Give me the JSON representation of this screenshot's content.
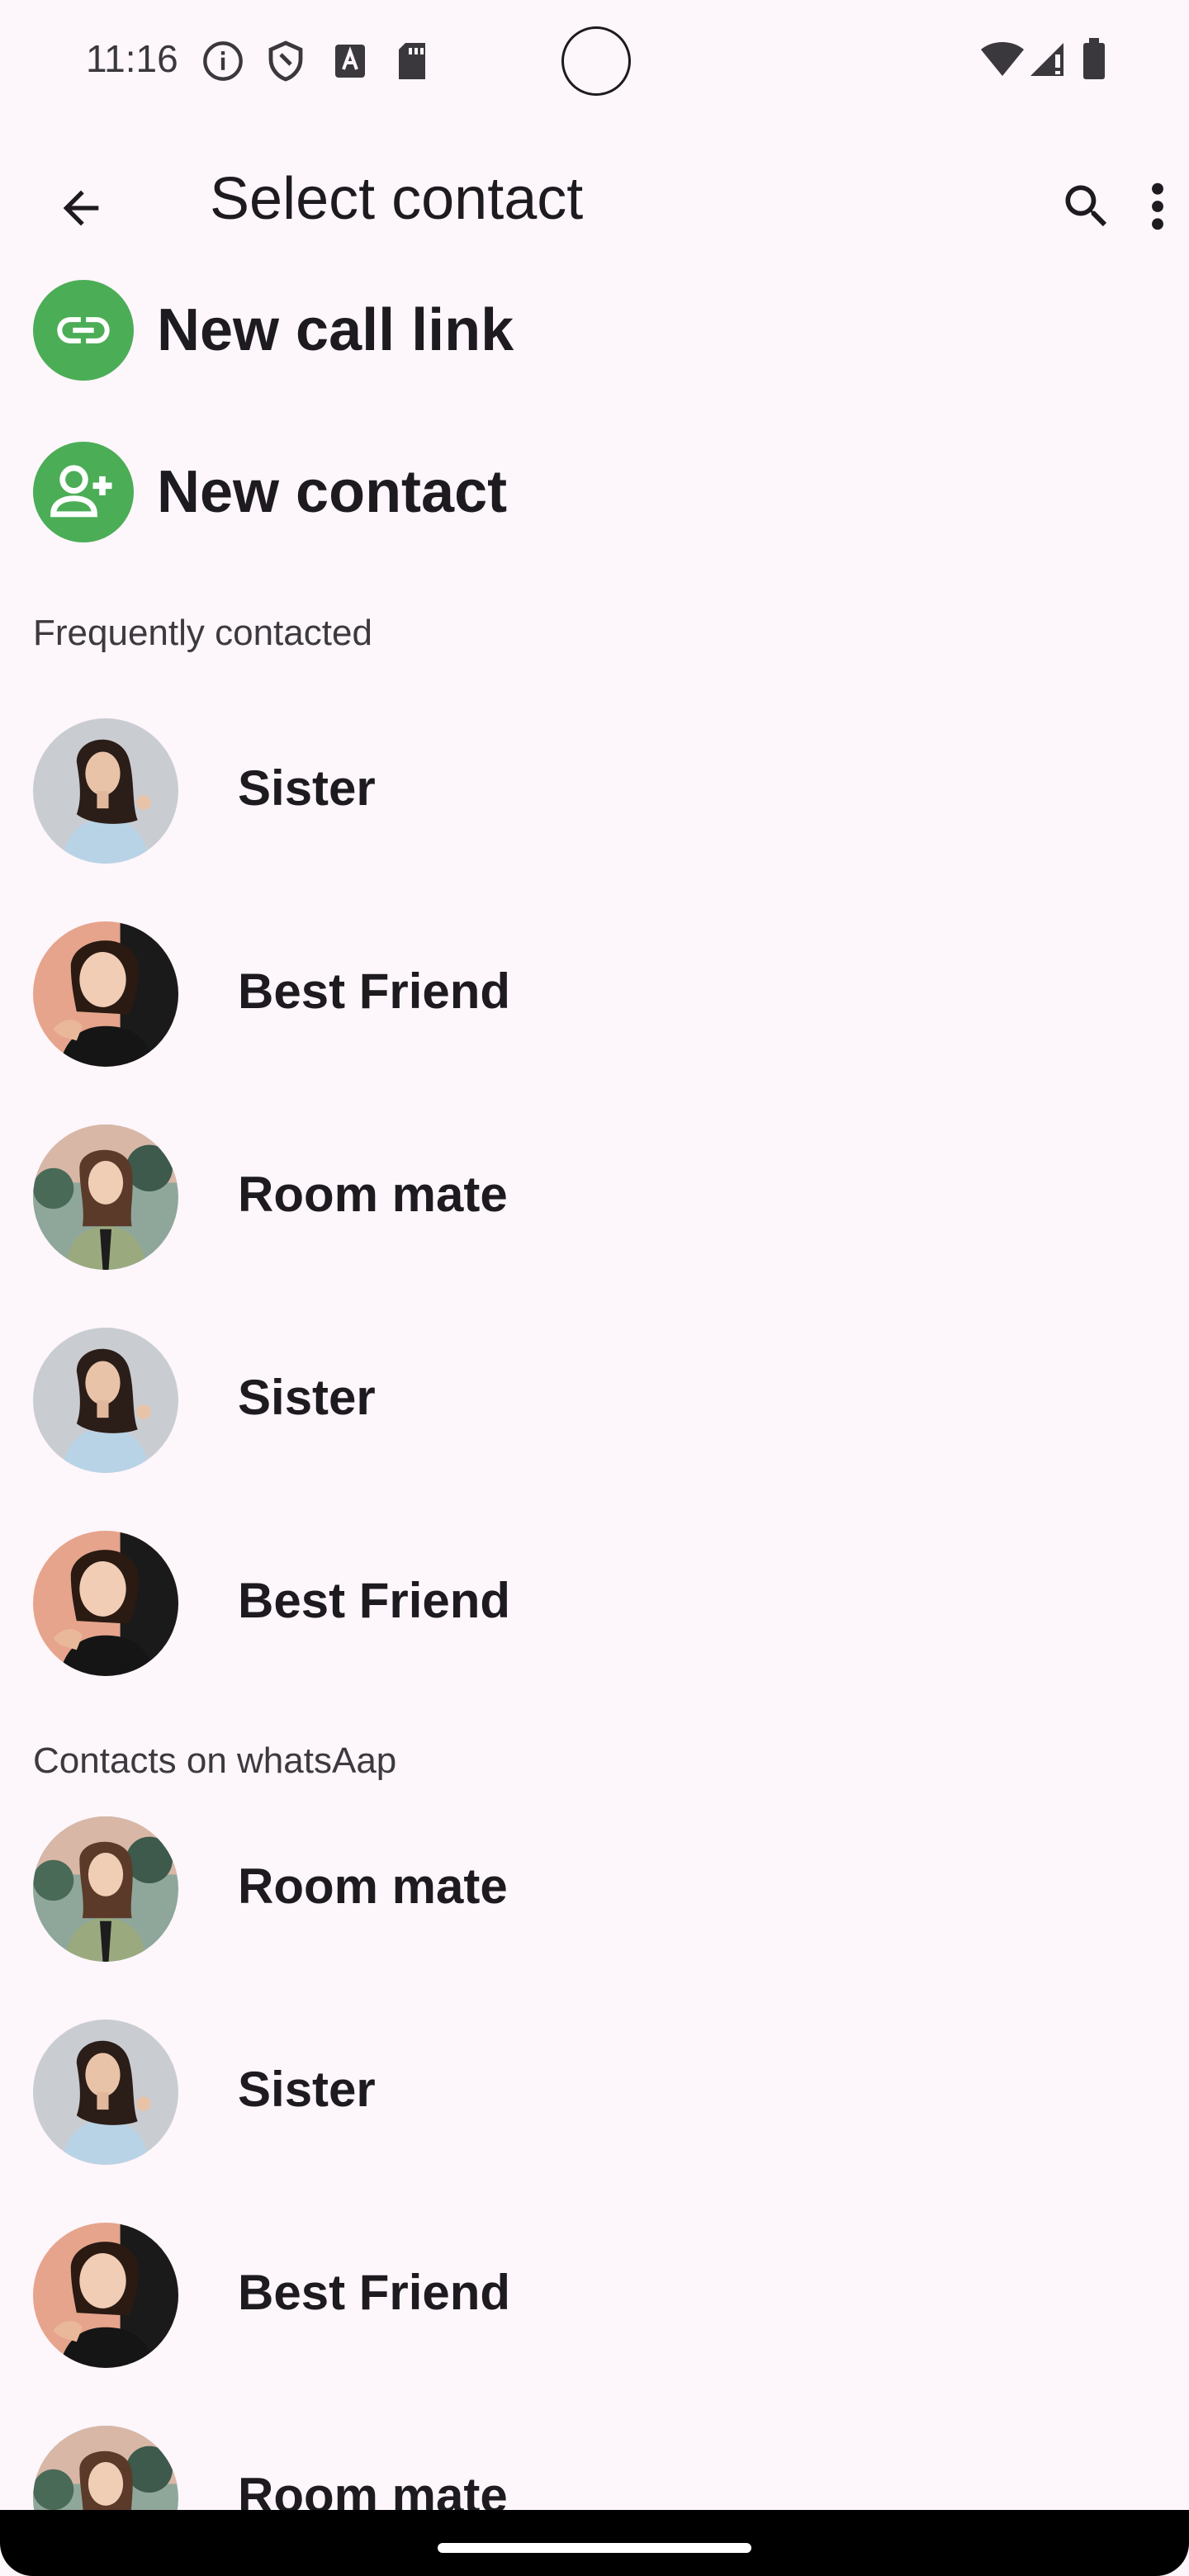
{
  "status_bar": {
    "time": "11:16"
  },
  "toolbar": {
    "title": "Select contact"
  },
  "actions": {
    "new_call_link": "New call link",
    "new_contact": "New contact"
  },
  "sections": {
    "frequent": "Frequently contacted",
    "on_app": "Contacts on whatsAap"
  },
  "frequent_contacts": [
    {
      "name": "Sister",
      "avatar": "sister"
    },
    {
      "name": "Best Friend",
      "avatar": "best-friend"
    },
    {
      "name": "Room mate",
      "avatar": "room-mate"
    },
    {
      "name": "Sister",
      "avatar": "sister"
    },
    {
      "name": "Best Friend",
      "avatar": "best-friend"
    }
  ],
  "app_contacts": [
    {
      "name": "Room mate",
      "avatar": "room-mate"
    },
    {
      "name": "Sister",
      "avatar": "sister"
    },
    {
      "name": "Best Friend",
      "avatar": "best-friend"
    },
    {
      "name": "Room mate",
      "avatar": "room-mate"
    }
  ],
  "colors": {
    "background": "#fdf6fb",
    "accent_green": "#4cad57"
  }
}
